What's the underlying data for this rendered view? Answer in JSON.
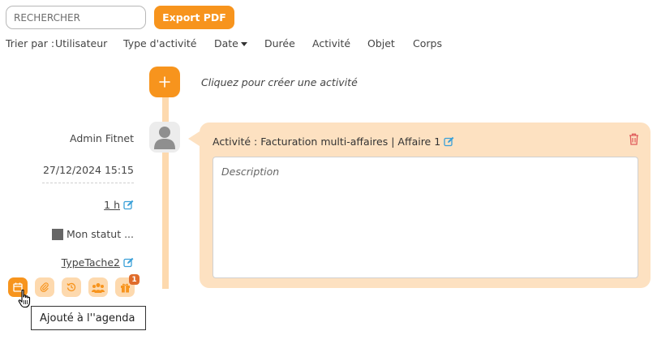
{
  "search": {
    "placeholder": "RECHERCHER",
    "value": ""
  },
  "toolbar": {
    "export_label": "Export PDF"
  },
  "sort": {
    "label": "Trier par :",
    "options": [
      "Utilisateur",
      "Type d'activité",
      "Date",
      "Durée",
      "Activité",
      "Objet",
      "Corps"
    ],
    "active": "Date"
  },
  "timeline": {
    "add_icon": "plus",
    "create_hint": "Cliquez pour créer une activité"
  },
  "activity": {
    "user": "Admin Fitnet",
    "datetime": "27/12/2024 15:15",
    "duration": "1 h",
    "status": "Mon statut ...",
    "status_color": "#666666",
    "task_type": "TypeTache2",
    "title": "Activité : Facturation multi-affaires | Affaire 1",
    "description_placeholder": "Description",
    "description_value": "",
    "icons": [
      "calendar-icon",
      "paperclip-icon",
      "history-icon",
      "group-icon",
      "gift-icon"
    ],
    "badge_count": "1"
  },
  "tooltip": {
    "text": "Ajouté à l''agenda"
  },
  "colors": {
    "accent": "#f7941d",
    "accent_light": "#fdd9ae",
    "card_bg": "#fde1c1",
    "edit": "#3aa0d8",
    "delete": "#e05b5b"
  }
}
